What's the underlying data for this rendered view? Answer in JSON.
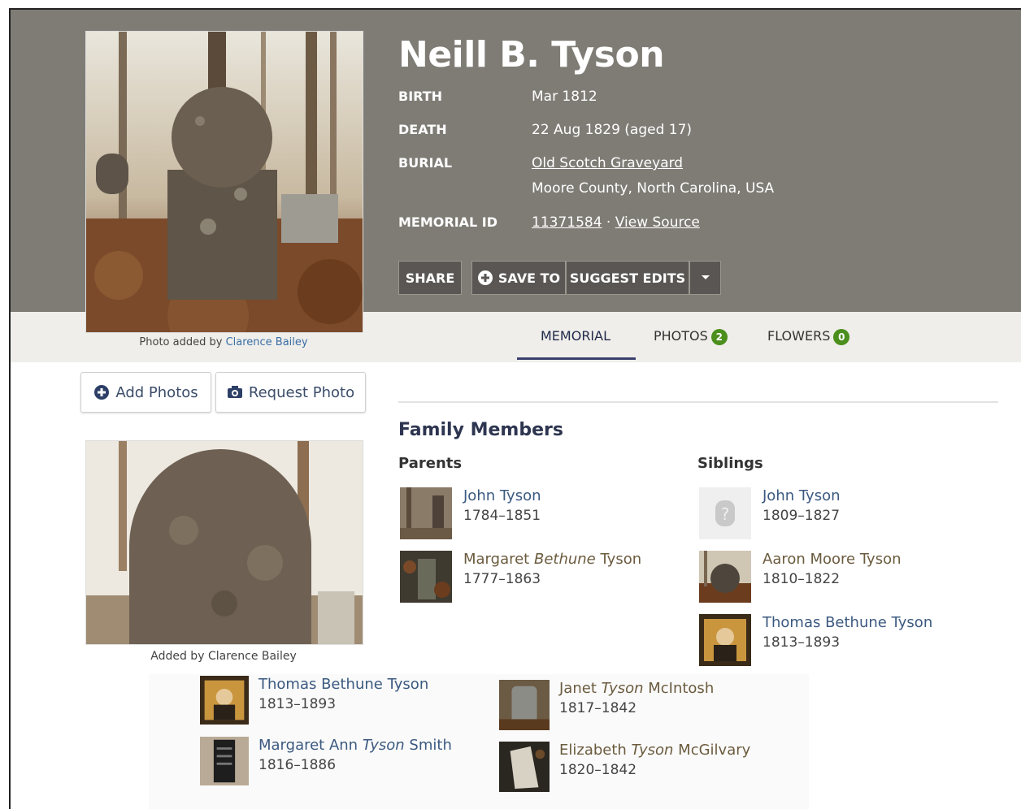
{
  "memorial": {
    "name": "Neill B. Tyson",
    "birth_label": "BIRTH",
    "birth_value": "Mar 1812",
    "death_label": "DEATH",
    "death_value": "22 Aug 1829 (aged 17)",
    "burial_label": "BURIAL",
    "burial_place": "Old Scotch Graveyard",
    "burial_location": "Moore County, North Carolina, USA",
    "memorial_id_label": "MEMORIAL ID",
    "memorial_id": "11371584",
    "memorial_id_sep": " · ",
    "view_source": "View Source"
  },
  "photo_credit": {
    "prefix": "Photo added by ",
    "name": "Clarence Bailey"
  },
  "actions": {
    "share": "SHARE",
    "save_to": "SAVE TO",
    "suggest_edits": "SUGGEST EDITS",
    "add_photos": "Add Photos",
    "request_photo": "Request Photo"
  },
  "tabs": {
    "memorial": "MEMORIAL",
    "photos": "PHOTOS",
    "photos_count": "2",
    "flowers": "FLOWERS",
    "flowers_count": "0"
  },
  "stone_credit": {
    "prefix": "Added by ",
    "name": "Clarence Bailey"
  },
  "family": {
    "title": "Family Members",
    "parents_label": "Parents",
    "siblings_label": "Siblings",
    "parents": [
      {
        "first": "John Tyson",
        "maiden": "",
        "last": "",
        "years": "1784–1851"
      },
      {
        "first": "Margaret ",
        "maiden": "Bethune",
        "last": " Tyson",
        "years": "1777–1863"
      }
    ],
    "siblings": [
      {
        "first": "John Tyson",
        "maiden": "",
        "last": "",
        "years": "1809–1827"
      },
      {
        "first": "Aaron Moore Tyson",
        "maiden": "",
        "last": "",
        "years": "1810–1822"
      },
      {
        "first": "Thomas Bethune Tyson",
        "maiden": "",
        "last": "",
        "years": "1813–1893"
      }
    ],
    "more_siblings": [
      {
        "first": "Thomas Bethune Tyson",
        "maiden": "",
        "last": "",
        "years": "1813–1893"
      },
      {
        "first": "Margaret Ann ",
        "maiden": "Tyson",
        "last": " Smith",
        "years": "1816–1886"
      },
      {
        "first": "Janet ",
        "maiden": "Tyson",
        "last": " McIntosh",
        "years": "1817–1842"
      },
      {
        "first": "Elizabeth ",
        "maiden": "Tyson",
        "last": " McGilvary",
        "years": "1820–1842"
      }
    ]
  },
  "colors": {
    "header_bg": "#7f7c76",
    "badge_green": "#4b8f1d",
    "link_blue": "#3b5980"
  }
}
